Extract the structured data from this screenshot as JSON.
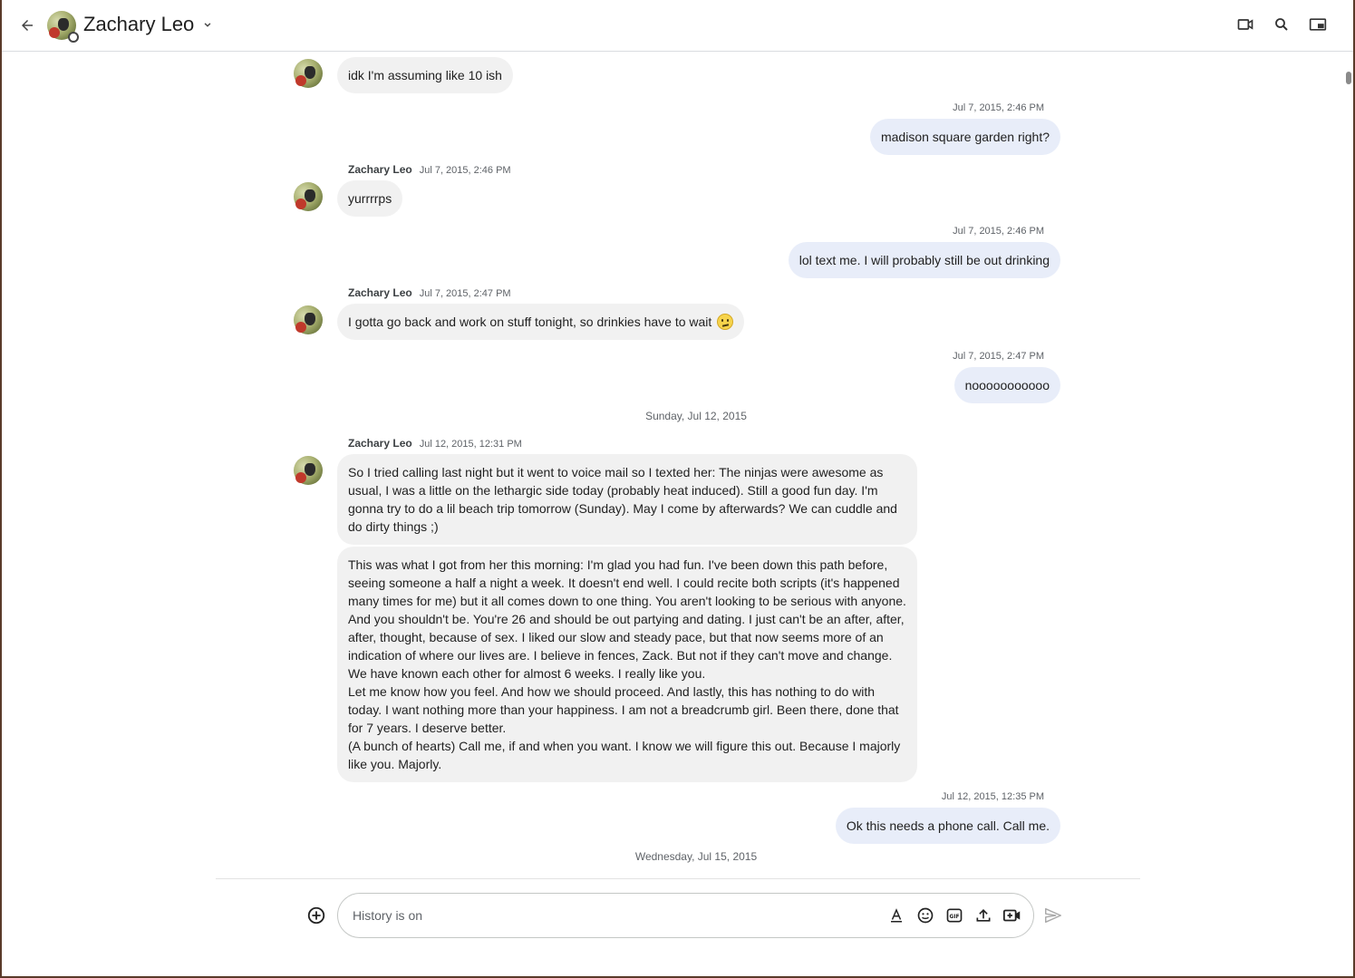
{
  "header": {
    "contact_name": "Zachary Leo"
  },
  "thread": {
    "messages": [
      {
        "dir": "in",
        "text": "idk I'm assuming like 10 ish"
      },
      {
        "dir": "out",
        "time": "Jul 7, 2015, 2:46 PM",
        "text": "madison square garden right?"
      },
      {
        "dir": "in",
        "sender": "Zachary Leo",
        "time": "Jul 7, 2015, 2:46 PM",
        "text": "yurrrrps"
      },
      {
        "dir": "out",
        "time": "Jul 7, 2015, 2:46 PM",
        "text": "lol text me.  I will probably still be out drinking"
      },
      {
        "dir": "in",
        "sender": "Zachary Leo",
        "time": "Jul 7, 2015, 2:47 PM",
        "text": "I gotta go back and work on stuff tonight, so drinkies have to wait",
        "emoji": "confused-face-emoji"
      },
      {
        "dir": "out",
        "time": "Jul 7, 2015, 2:47 PM",
        "text": "nooooooooooo"
      },
      {
        "dir": "in",
        "sender": "Zachary Leo",
        "time": "Jul 12, 2015, 12:31 PM",
        "text": "So I tried calling last night but it went to voice mail so I texted her: The ninjas were awesome as usual, I was a little on the lethargic side today (probably heat induced). Still a good fun day. I'm gonna try to do a lil beach trip tomorrow (Sunday). May I come by afterwards? We can cuddle and do dirty things ;)"
      },
      {
        "dir": "in",
        "text": "This was what I got from her this morning: I'm glad you had fun. I've been down this path before, seeing someone a half a night a week. It doesn't end well. I could recite both scripts (it's happened many times for me) but it all comes down to one thing. You aren't looking to be serious with anyone. And you shouldn't be. You're 26 and should be out partying and dating. I just can't be an after, after, after, thought, because of sex. I liked our slow and steady pace, but that now seems more of an indication of where our lives are. I believe in fences, Zack. But not if they can't move and change. We have known each other for almost 6 weeks. I really like you.\nLet me know how you feel. And how we should proceed.  And lastly, this has nothing to do with today. I want nothing more than your happiness.  I am not a breadcrumb girl. Been there, done that for 7 years.  I deserve better.\n(A bunch of hearts) Call me, if and when you want. I know we will figure this out. Because I majorly like you. Majorly."
      },
      {
        "dir": "out",
        "time": "Jul 12, 2015, 12:35 PM",
        "text": "Ok this needs a phone call. Call me."
      }
    ],
    "day_separators": [
      "Sunday, Jul 12, 2015",
      "Wednesday, Jul 15, 2015"
    ]
  },
  "composer": {
    "placeholder": "History is on"
  },
  "icons": {
    "back": "back-arrow-icon",
    "video": "video-call-icon",
    "search": "search-icon",
    "pip": "picture-in-picture-icon",
    "add": "add-circle-icon",
    "format": "text-format-icon",
    "emoji": "emoji-icon",
    "gif": "gif-icon",
    "upload": "upload-icon",
    "video_add": "add-video-icon",
    "send": "send-icon"
  }
}
